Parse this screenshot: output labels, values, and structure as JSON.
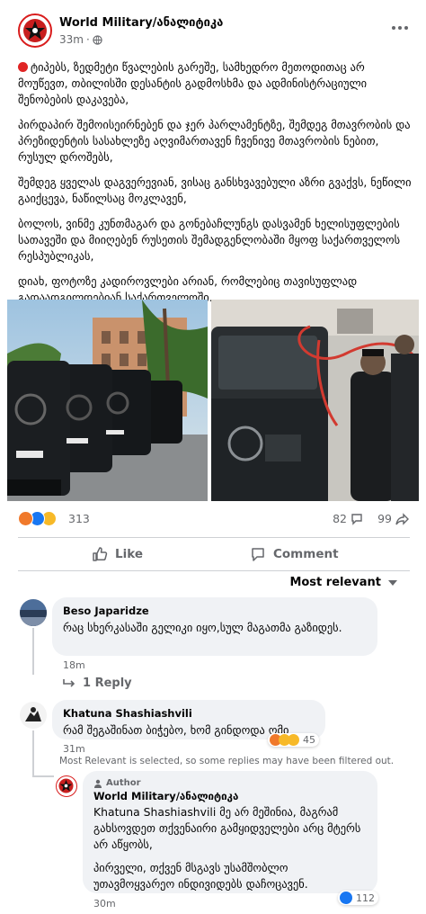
{
  "post": {
    "page_name": "World Military/ანალიტიკა",
    "time": "33m",
    "paragraphs": [
      "ტიპებს, ზედმეტი წვალების გარეშე, სამხედრო მეთოდითაც არ მოუწევთ, თბილისში დესანტის გადმოსხმა და ადმინისტრაციული შენობების დაკავება,",
      "პირდაპირ შემოისეირნებენ და ჯერ პარლამენტზე, შემდეგ მთავრობის და პრეზიდენტის სასახლეზე აღვიმართავენ ჩვენივე მთავრობის ნებით, რუსულ დროშებს,",
      "შემდეგ ყველას დაგვერევიან, ვისაც განსხვავებული აზრი გვაქვს, ნეწილი გაიქცევა, ნაწილსაც მოკლავენ,",
      "ბოლოს, ვინმე კუნთმაგარ და გონებაჩლუნგს დასვამენ ხელისუფლების სათავეში და მიიღებენ რუსეთის შემადგენლობაში მყოფ საქართველოს რესპუბლიკას,",
      "დიახ, ფოტოზე კადიროვლები არიან, რომლებიც თავისუფლად გადაადგილდებიან საქართველოში."
    ]
  },
  "stats": {
    "reactions_count": "313",
    "comments_count": "82",
    "shares_count": "99"
  },
  "actions": {
    "like_label": "Like",
    "comment_label": "Comment"
  },
  "sort_label": "Most relevant",
  "comments": [
    {
      "author": "Beso Japaridze",
      "text": "რაც სხერკასაში გელიკი იყო,სულ მაგათმა გაზიდეს.",
      "time": "18m",
      "reply_label": "1 Reply"
    },
    {
      "author": "Khatuna Shashiashvili",
      "text": "რამ შეგაშინათ ბიჭებო, ხომ გინდოდა ომი",
      "time": "31m",
      "reaction_count": "45"
    }
  ],
  "filter_note": "Most Relevant is selected, so some replies may have been filtered out.",
  "reply": {
    "badge": "Author",
    "author": "World Military/ანალიტიკა",
    "text1": "Khatuna Shashiashvili მე არ მეშინია, მაგრამ გახსოვდეთ თქვენაირი გამყიდველები არც მტერს არ აწყობს,",
    "text2": "პირველი, თქვენ მსგავს უსამშობლო უთავმოყვარეო ინდივიდებს დაჩოცავენ.",
    "time": "30m",
    "reaction_count": "112"
  },
  "colors": {
    "accent": "#1877f2",
    "text_secondary": "#65676b",
    "bubble": "#f0f2f5",
    "logo_red": "#d91c1c"
  },
  "icons": [
    "globe-icon",
    "more-icon",
    "angry-react-icon",
    "like-react-icon",
    "sad-react-icon",
    "comment-icon",
    "share-icon",
    "like-icon",
    "reply-arrow-icon",
    "caret-down-icon",
    "author-badge-icon"
  ]
}
